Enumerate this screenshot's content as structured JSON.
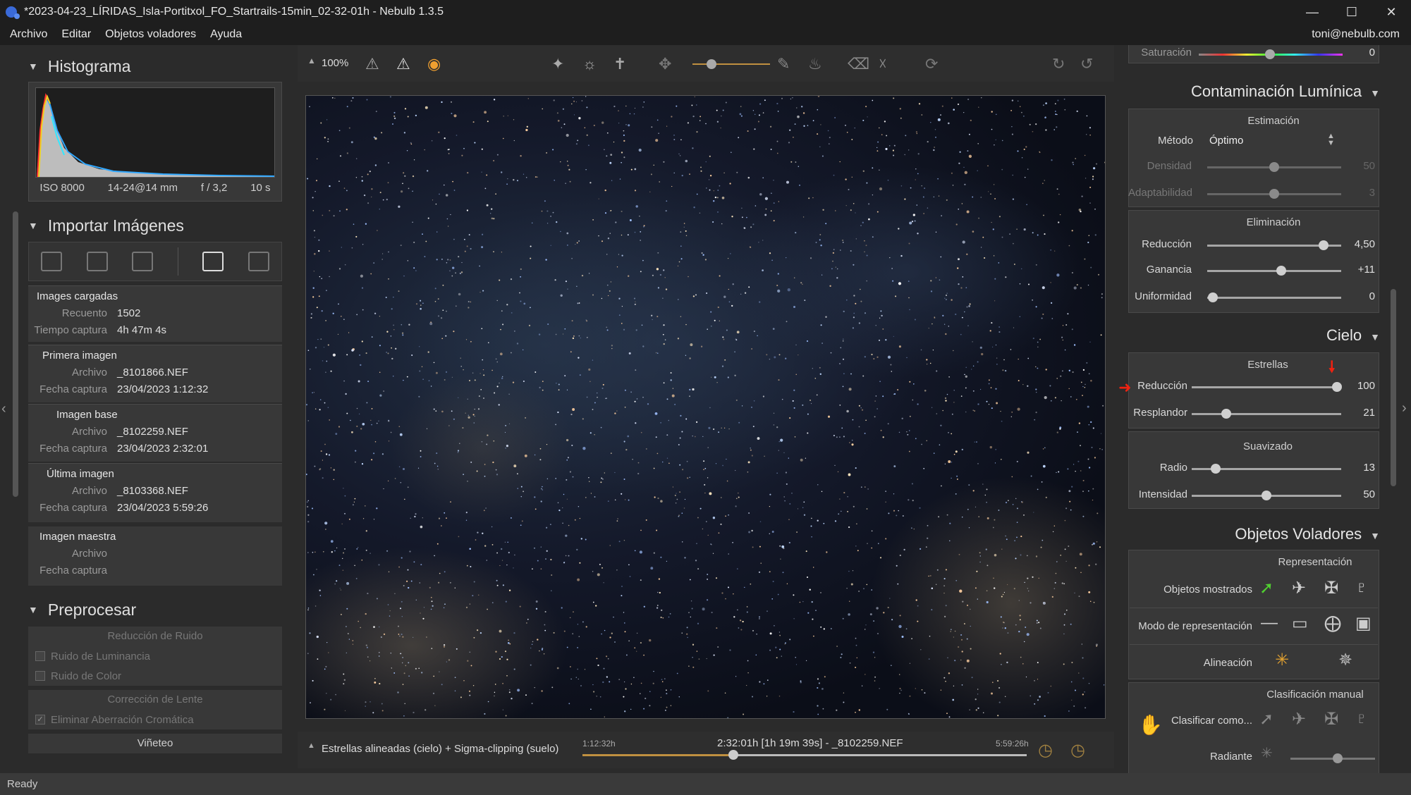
{
  "window": {
    "title": "*2023-04-23_LÍRIDAS_Isla-Portitxol_FO_Startrails-15min_02-32-01h - Nebulb 1.3.5"
  },
  "menu": {
    "items": [
      "Archivo",
      "Editar",
      "Objetos voladores",
      "Ayuda"
    ],
    "user": "toni@nebulb.com"
  },
  "histogram": {
    "title": "Histograma",
    "iso": "ISO 8000",
    "lens": "14-24@14 mm",
    "aperture": "f / 3,2",
    "exposure": "10 s"
  },
  "import": {
    "title": "Importar Imágenes",
    "loaded": {
      "header": "Images cargadas",
      "count_label": "Recuento",
      "count": "1502",
      "time_label": "Tiempo captura",
      "time": "4h 47m 4s"
    },
    "first": {
      "header": "Primera imagen",
      "file_label": "Archivo",
      "file": "_8101866.NEF",
      "date_label": "Fecha captura",
      "date": "23/04/2023 1:12:32"
    },
    "base": {
      "header": "Imagen base",
      "file_label": "Archivo",
      "file": "_8102259.NEF",
      "date_label": "Fecha captura",
      "date": "23/04/2023 2:32:01"
    },
    "last": {
      "header": "Última imagen",
      "file_label": "Archivo",
      "file": "_8103368.NEF",
      "date_label": "Fecha captura",
      "date": "23/04/2023 5:59:26"
    },
    "master": {
      "header": "Imagen maestra",
      "file_label": "Archivo",
      "date_label": "Fecha captura"
    }
  },
  "preprocess": {
    "title": "Preprocesar",
    "noise": "Reducción de Ruido",
    "luminance": "Ruido de Luminancia",
    "color": "Ruido de Color",
    "lens": "Corrección de Lente",
    "chroma": "Eliminar Aberración Cromática",
    "vignette": "Viñeteo"
  },
  "toolbar": {
    "zoom": "100%"
  },
  "bottom": {
    "mode": "Estrellas alineadas (cielo) + Sigma-clipping (suelo)",
    "start": "1:12:32h",
    "current": "2:32:01h [1h 19m 39s] - _8102259.NEF",
    "end": "5:59:26h",
    "position": 0.34
  },
  "right": {
    "saturation_label": "Saturación",
    "saturation_value": "0",
    "light_pollution": {
      "title": "Contaminación Lumínica",
      "estimation": "Estimación",
      "method_label": "Método",
      "method_value": "Óptimo",
      "density_label": "Densidad",
      "density_value": "50",
      "density_pos": 0.5,
      "adapt_label": "Adaptabilidad",
      "adapt_value": "3",
      "adapt_pos": 0.5,
      "elimination": "Eliminación",
      "reduction_label": "Reducción",
      "reduction_value": "4,50",
      "reduction_pos": 0.87,
      "gain_label": "Ganancia",
      "gain_value": "+11",
      "gain_pos": 0.55,
      "uniformity_label": "Uniformidad",
      "uniformity_value": "0",
      "uniformity_pos": 0.04
    },
    "sky": {
      "title": "Cielo",
      "stars": "Estrellas",
      "reduction_label": "Reducción",
      "reduction_value": "100",
      "reduction_pos": 0.97,
      "glow_label": "Resplandor",
      "glow_value": "21",
      "glow_pos": 0.23,
      "smoothing": "Suavizado",
      "radius_label": "Radio",
      "radius_value": "13",
      "radius_pos": 0.16,
      "intensity_label": "Intensidad",
      "intensity_value": "50",
      "intensity_pos": 0.5
    },
    "flying": {
      "title": "Objetos Voladores",
      "representation": "Representación",
      "shown_label": "Objetos mostrados",
      "mode_label": "Modo de representación",
      "alignment_label": "Alineación",
      "manual": "Clasificación manual",
      "classify_label": "Clasificar como...",
      "radiant_label": "Radiante"
    }
  },
  "status": "Ready"
}
